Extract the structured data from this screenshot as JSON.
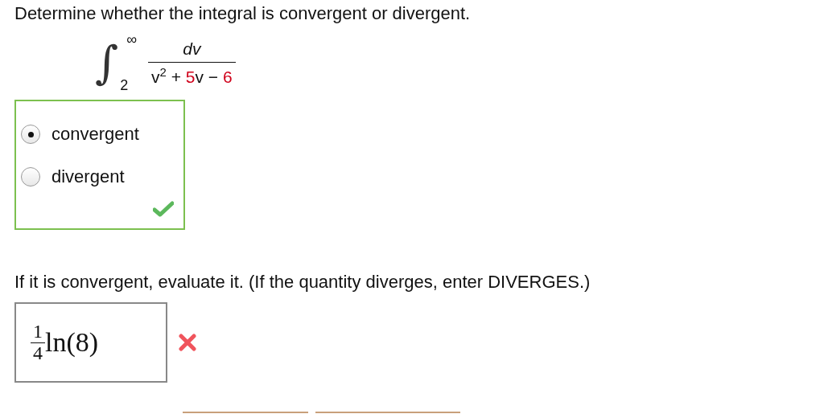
{
  "question": "Determine whether the integral is convergent or divergent.",
  "integral": {
    "sign": "∫",
    "upper": "∞",
    "lower": "2",
    "numerator": "dv",
    "denominator": [
      {
        "kind": "plain",
        "text": "v"
      },
      {
        "kind": "sup",
        "text": "2"
      },
      {
        "kind": "plain",
        "text": " + "
      },
      {
        "kind": "given",
        "text": "5"
      },
      {
        "kind": "plain",
        "text": "v − "
      },
      {
        "kind": "given",
        "text": "6"
      }
    ]
  },
  "choices": {
    "correct": true,
    "options": [
      {
        "label": "convergent",
        "selected": true
      },
      {
        "label": "divergent",
        "selected": false
      }
    ]
  },
  "prompt": "If it is convergent, evaluate it. (If the quantity diverges, enter DIVERGES.)",
  "answer": {
    "numerator": "1",
    "denominator": "4",
    "expression": "ln(8)",
    "correct": false
  }
}
